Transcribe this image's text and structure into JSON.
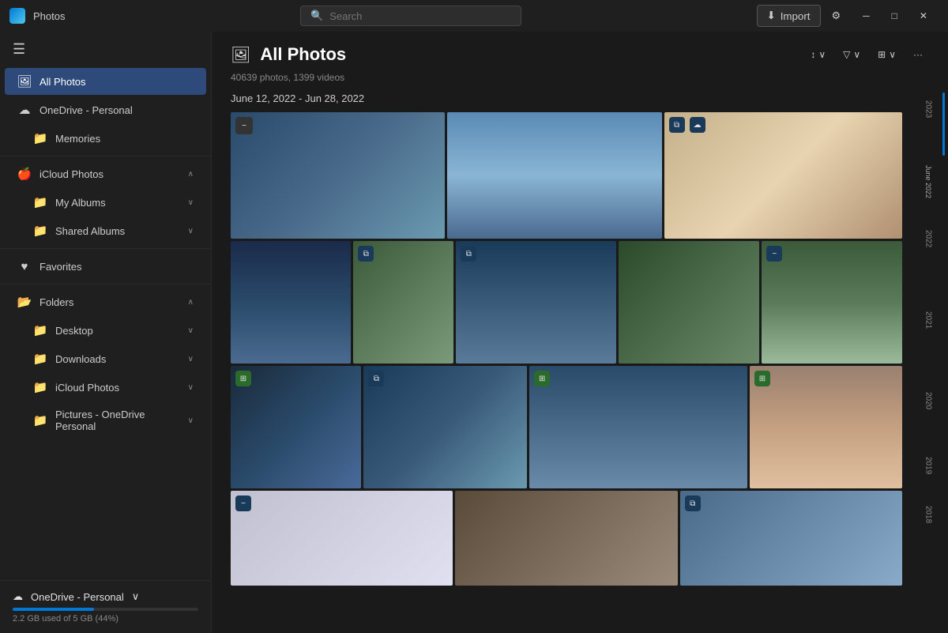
{
  "app": {
    "title": "Photos",
    "icon_color": "#0078d4"
  },
  "titlebar": {
    "search_placeholder": "Search",
    "import_label": "Import",
    "settings_icon": "⚙",
    "minimize_label": "─",
    "maximize_label": "□",
    "close_label": "✕"
  },
  "sidebar": {
    "menu_icon": "☰",
    "items": [
      {
        "id": "all-photos",
        "icon": "🖼",
        "label": "All Photos",
        "active": true,
        "indent": false
      },
      {
        "id": "onedrive",
        "icon": "☁",
        "label": "OneDrive - Personal",
        "active": false,
        "indent": false
      },
      {
        "id": "memories",
        "icon": "📁",
        "label": "Memories",
        "active": false,
        "indent": true
      }
    ],
    "icloud_section": {
      "label": "iCloud Photos",
      "icon": "🍎",
      "expanded": true,
      "children": [
        {
          "id": "my-albums",
          "icon": "📁",
          "label": "My Albums",
          "chevron": "∨"
        },
        {
          "id": "shared-albums",
          "icon": "📁",
          "label": "Shared Albums",
          "chevron": "∨"
        }
      ]
    },
    "favorites": {
      "id": "favorites",
      "icon": "♥",
      "label": "Favorites"
    },
    "folders_section": {
      "label": "Folders",
      "expanded": true,
      "children": [
        {
          "id": "desktop",
          "icon": "📁",
          "label": "Desktop",
          "chevron": "∨"
        },
        {
          "id": "downloads",
          "icon": "📁",
          "label": "Downloads",
          "chevron": "∨"
        },
        {
          "id": "icloud-photos",
          "icon": "📁",
          "label": "iCloud Photos",
          "chevron": "∨"
        },
        {
          "id": "pictures-onedrive",
          "icon": "📁",
          "label": "Pictures - OneDrive Personal",
          "chevron": "∨"
        }
      ]
    },
    "bottom": {
      "label": "OneDrive - Personal",
      "icon": "☁",
      "storage_text": "2.2 GB used of 5 GB (44%)",
      "progress_percent": 44
    }
  },
  "content": {
    "page_icon": "🖼",
    "page_title": "All Photos",
    "photo_count": "40639 photos, 1399 videos",
    "date_range": "June 12, 2022 - Jun 28, 2022",
    "toolbar": {
      "sort_label": "↕",
      "filter_label": "▽",
      "view_label": "⊞",
      "more_label": "···"
    },
    "year_labels": [
      "2023",
      "June 2022",
      "2022",
      "2021",
      "2020",
      "2019",
      "2018"
    ]
  }
}
